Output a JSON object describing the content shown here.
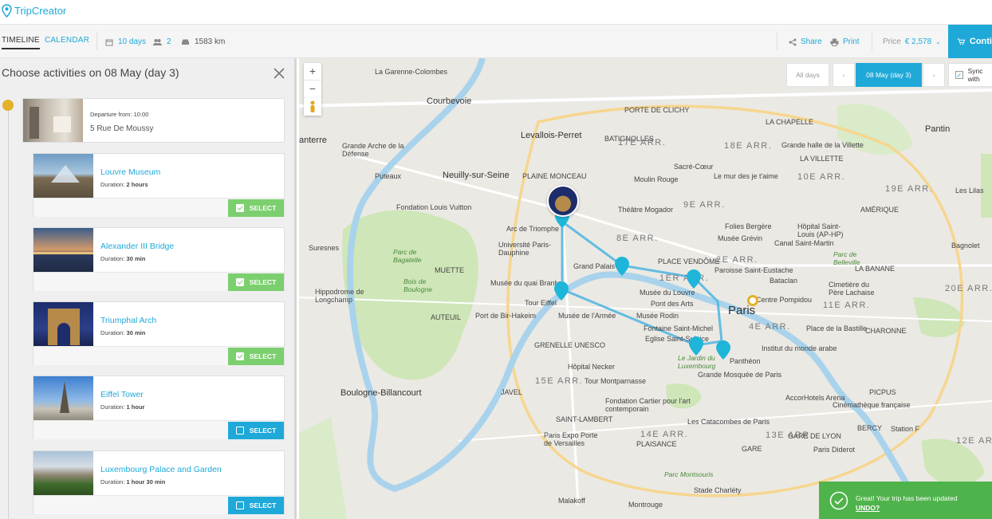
{
  "app": {
    "name": "TripCreator"
  },
  "toolbar": {
    "tab_timeline": "TIMELINE",
    "tab_calendar": "CALENDAR",
    "days": "10 days",
    "travellers": "2",
    "distance": "1583 km",
    "share": "Share",
    "print": "Print",
    "price_label": "Price",
    "price": "€ 2,578",
    "continue": "Conti"
  },
  "panel": {
    "title": "Choose activities on 08 May (day 3)",
    "departure": {
      "label": "Departure from: 10:00",
      "address": "5 Rue De Moussy"
    },
    "activities": [
      {
        "name": "Louvre Museum",
        "duration_label": "Duration:",
        "duration": "2 hours",
        "button": "SELECT",
        "selected": true
      },
      {
        "name": "Alexander III Bridge",
        "duration_label": "Duration:",
        "duration": "30 min",
        "button": "SELECT",
        "selected": true
      },
      {
        "name": "Triumphal Arch",
        "duration_label": "Duration:",
        "duration": "30 min",
        "button": "SELECT",
        "selected": true
      },
      {
        "name": "Eiffel Tower",
        "duration_label": "Duration:",
        "duration": "1 hour",
        "button": "SELECT",
        "selected": false
      },
      {
        "name": "Luxembourg Palace and Garden",
        "duration_label": "Duration:",
        "duration": "1 hour 30 min",
        "button": "SELECT",
        "selected": false
      }
    ]
  },
  "map": {
    "zoom_in": "+",
    "zoom_out": "−",
    "all_days": "All days",
    "current_day": "08 May (day 3)",
    "sync": "Sync with",
    "labels": [
      "La Garenne-Colombes",
      "Courbevoie",
      "Levallois-Perret",
      "anterre",
      "Grande Arche de la Défense",
      "Puteaux",
      "Neuilly-sur-Seine",
      "Fondation Louis Vuitton",
      "Suresnes",
      "Parc de Bagatelle",
      "Bois de Boulogne",
      "MUETTE",
      "AUTEUIL",
      "Hippodrome de Longchamp",
      "Boulogne-Billancourt",
      "Arc de Triomphe",
      "Université Paris-Dauphine",
      "Grand Palais",
      "Musée du quai Branly",
      "Tour Eiffel",
      "Port de Bir-Hakeim",
      "Musée de l'Armée",
      "Musée Rodin",
      "GRENELLE UNESCO",
      "Hôpital Necker",
      "Tour Montparnasse",
      "Fondation Cartier pour l'art contemporain",
      "Les Catacombes de Paris",
      "Paris Expo Porte de Versailles",
      "Malakoff",
      "Montrouge",
      "Stade Charléty",
      "Musée du Louvre",
      "Pont des Arts",
      "Fontaine Saint-Michel",
      "Eglise Saint-Sulpice",
      "Panthéon",
      "Grande Mosquée de Paris",
      "Paris",
      "Sacré-Cœur",
      "Le mur des je t'aime",
      "Théâtre Mogador",
      "Folies Bergère",
      "Musée Grévin",
      "Paroisse Saint-Eustache",
      "Bataclan",
      "Cimetière du Père Lachaise",
      "Place de la Bastille",
      "Institut du monde arabe",
      "AccorHotels Arena",
      "Cinémathèque française",
      "Station F",
      "Pantin",
      "Grande halle de la Villette",
      "LA VILLETTE",
      "Les Lilas",
      "Bagnolet",
      "Hôpital Saint-Louis (AP-HP)",
      "Canal Saint-Martin",
      "Parc de Belleville",
      "LA BANANE",
      "AMÉRIQUE",
      "CHARONNE",
      "PICPUS",
      "GARE DE LYON",
      "BERCY",
      "Paris Diderot",
      "PORTE DE CLICHY",
      "BATIGNOLLES",
      "PLAINE MONCEAU",
      "Moulin Rouge",
      "LA CHAPELLE",
      "PLACE VENDÔME",
      "JAVEL",
      "SAINT-LAMBERT",
      "PLAISANCE",
      "GARE",
      "Parc Montsouris",
      "Le Jardin du Luxembourg",
      "Centre Pompidou"
    ],
    "arrondissements": [
      "17E ARR.",
      "18E ARR.",
      "19E ARR.",
      "9E ARR.",
      "8E ARR.",
      "2E ARR.",
      "1ER ARR.",
      "4E ARR.",
      "11E ARR.",
      "15E ARR.",
      "14E ARR.",
      "13E ARR.",
      "12E ARR.",
      "10E ARR.",
      "20E ARR."
    ]
  },
  "toast": {
    "message": "Great! Your trip has been updated",
    "undo": "UNDO?"
  },
  "colors": {
    "accent": "#1fa9d8",
    "success": "#7ccf6e",
    "toast": "#4fb34b",
    "timeline_dot": "#e3b22b"
  }
}
